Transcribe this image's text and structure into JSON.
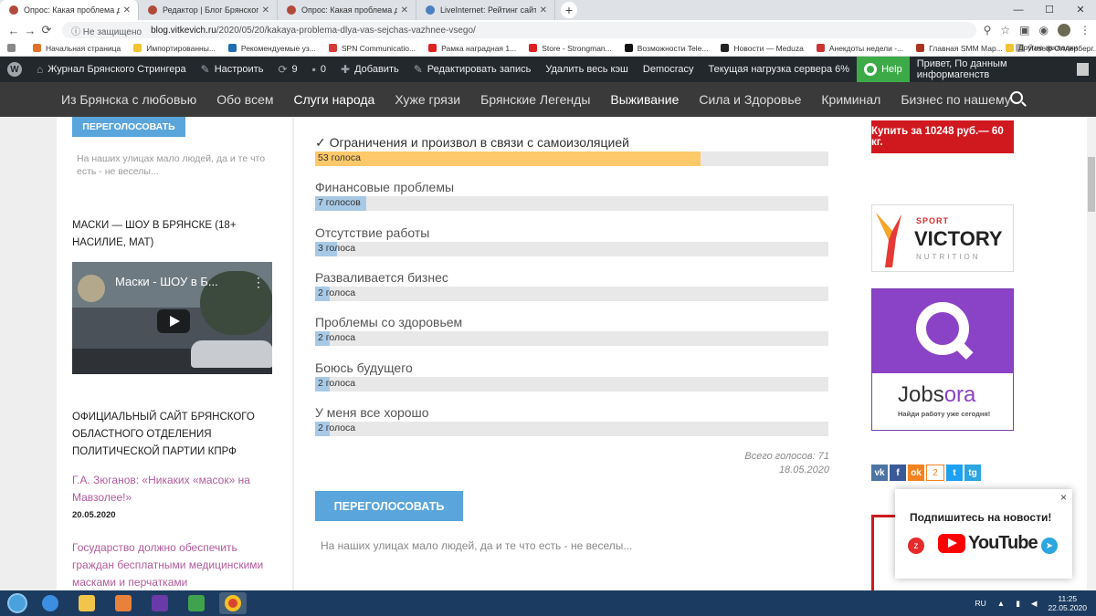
{
  "browser": {
    "tabs": [
      {
        "title": "Опрос: Какая проблема для вас",
        "active": true,
        "favicon_color": "#b14a3a"
      },
      {
        "title": "Редактор | Блог Брянского Стри",
        "active": false,
        "favicon_color": "#b14a3a"
      },
      {
        "title": "Опрос: Какая проблема для ва",
        "active": false,
        "favicon_color": "#b14a3a"
      },
      {
        "title": "LiveInternet: Рейтинг сайтов",
        "active": false,
        "favicon_color": "#4a7fc1"
      }
    ],
    "insecure_label": "Не защищено",
    "url_domain": "blog.vitkevich.ru",
    "url_path": "/2020/05/20/kakaya-problema-dlya-vas-sejchas-vazhnee-vsego/",
    "bookmarks": [
      {
        "label": "Начальная страница",
        "color": "#e0702a"
      },
      {
        "label": "Импортированны...",
        "color": "#f1c232"
      },
      {
        "label": "Рекомендуемые уз...",
        "color": "#1f6eb4"
      },
      {
        "label": "SPN Communicatio...",
        "color": "#d83a3a"
      },
      {
        "label": "Рамка наградная 1...",
        "color": "#d22"
      },
      {
        "label": "Store - Strongman...",
        "color": "#d22"
      },
      {
        "label": "Возможности Tele...",
        "color": "#111"
      },
      {
        "label": "Новости — Meduza",
        "color": "#222"
      },
      {
        "label": "Анекдоты недели -...",
        "color": "#c33"
      },
      {
        "label": "Главная SMM Мар...",
        "color": "#a32"
      },
      {
        "label": "Йозеф Оллерберг...",
        "color": "#aaa"
      }
    ],
    "other_bookmarks": "Другие закладки"
  },
  "wp_admin": {
    "site_name": "Журнал Брянского Стрингера",
    "customize": "Настроить",
    "updates": "9",
    "comments": "0",
    "add_new": "Добавить",
    "edit_post": "Редактировать запись",
    "clear_cache": "Удалить весь кэш",
    "democracy": "Democracy",
    "server_load": "Текущая нагрузка сервера 6%",
    "help": "Help",
    "greeting": "Привет, По данным информагенств"
  },
  "site_nav": [
    {
      "label": "Из Брянска с любовью",
      "highlight": false
    },
    {
      "label": "Обо всем",
      "highlight": false
    },
    {
      "label": "Слуги народа",
      "highlight": true
    },
    {
      "label": "Хуже грязи",
      "highlight": false
    },
    {
      "label": "Брянские Легенды",
      "highlight": false
    },
    {
      "label": "Выживание",
      "highlight": true
    },
    {
      "label": "Сила и Здоровье",
      "highlight": false
    },
    {
      "label": "Криминал",
      "highlight": false
    },
    {
      "label": "Бизнес по нашему",
      "highlight": false
    }
  ],
  "left_sidebar": {
    "revote_btn": "ПЕРЕГОЛОСОВАТЬ",
    "note": "На наших улицах мало людей, да и те что есть - не веселы...",
    "video_section_title": "МАСКИ — ШОУ В БРЯНСКЕ (18+ НАСИЛИЕ, МАТ)",
    "video_title": "Маски - ШОУ в Б...",
    "party_section_title": "ОФИЦИАЛЬНЫЙ САЙТ БРЯНСКОГО ОБЛАСТНОГО ОТДЕЛЕНИЯ ПОЛИТИЧЕСКОЙ ПАРТИИ КПРФ",
    "posts": [
      {
        "title": "Г.А. Зюганов: «Никаких «масок» на Мавзолее!»",
        "date": "20.05.2020"
      },
      {
        "title": "Государство должно обеспечить граждан бесплатными медицинскими масками и перчатками",
        "date": ""
      }
    ]
  },
  "poll": {
    "answers": [
      {
        "label": "✓ Ограничения и произвол в связи с самоизоляцией",
        "votes_label": "53 голоса",
        "votes": 53,
        "winner": true
      },
      {
        "label": "Финансовые проблемы",
        "votes_label": "7 голосов",
        "votes": 7,
        "winner": false
      },
      {
        "label": "Отсутствие работы",
        "votes_label": "3 голоса",
        "votes": 3,
        "winner": false
      },
      {
        "label": "Разваливается бизнес",
        "votes_label": "2 голоса",
        "votes": 2,
        "winner": false
      },
      {
        "label": "Проблемы со здоровьем",
        "votes_label": "2 голоса",
        "votes": 2,
        "winner": false
      },
      {
        "label": "Боюсь будущего",
        "votes_label": "2 голоса",
        "votes": 2,
        "winner": false
      },
      {
        "label": "У меня все хорошо",
        "votes_label": "2 голоса",
        "votes": 2,
        "winner": false
      }
    ],
    "total": "Всего голосов: 71",
    "date": "18.05.2020",
    "revote_btn": "ПЕРЕГОЛОСОВАТЬ",
    "note": "На наших улицах мало людей, да и те что есть - не веселы..."
  },
  "right_sidebar": {
    "ad_buy": "Купить за 10248 руб.— 60 кг.",
    "victory_sport": "SPORT",
    "victory_name": "VICTORY",
    "victory_nutrition": "NUTRITION",
    "jobsora_name_a": "Jobs",
    "jobsora_name_b": "ora",
    "jobsora_sub": "Найди работу уже сегодня!",
    "social": [
      {
        "label": "vk",
        "color": "#4c75a3"
      },
      {
        "label": "f",
        "color": "#3b5998"
      },
      {
        "label": "ok",
        "color": "#f58220"
      }
    ],
    "ok_count": "2",
    "social_tail": [
      {
        "label": "t",
        "color": "#1da1f2"
      },
      {
        "label": "tg",
        "color": "#2ca5e0"
      }
    ]
  },
  "popup": {
    "title": "Подпишитесь на новости!",
    "youtube": "YouTube",
    "close": "×"
  },
  "taskbar": {
    "lang": "RU",
    "time": "11:25",
    "date": "22.05.2020"
  }
}
